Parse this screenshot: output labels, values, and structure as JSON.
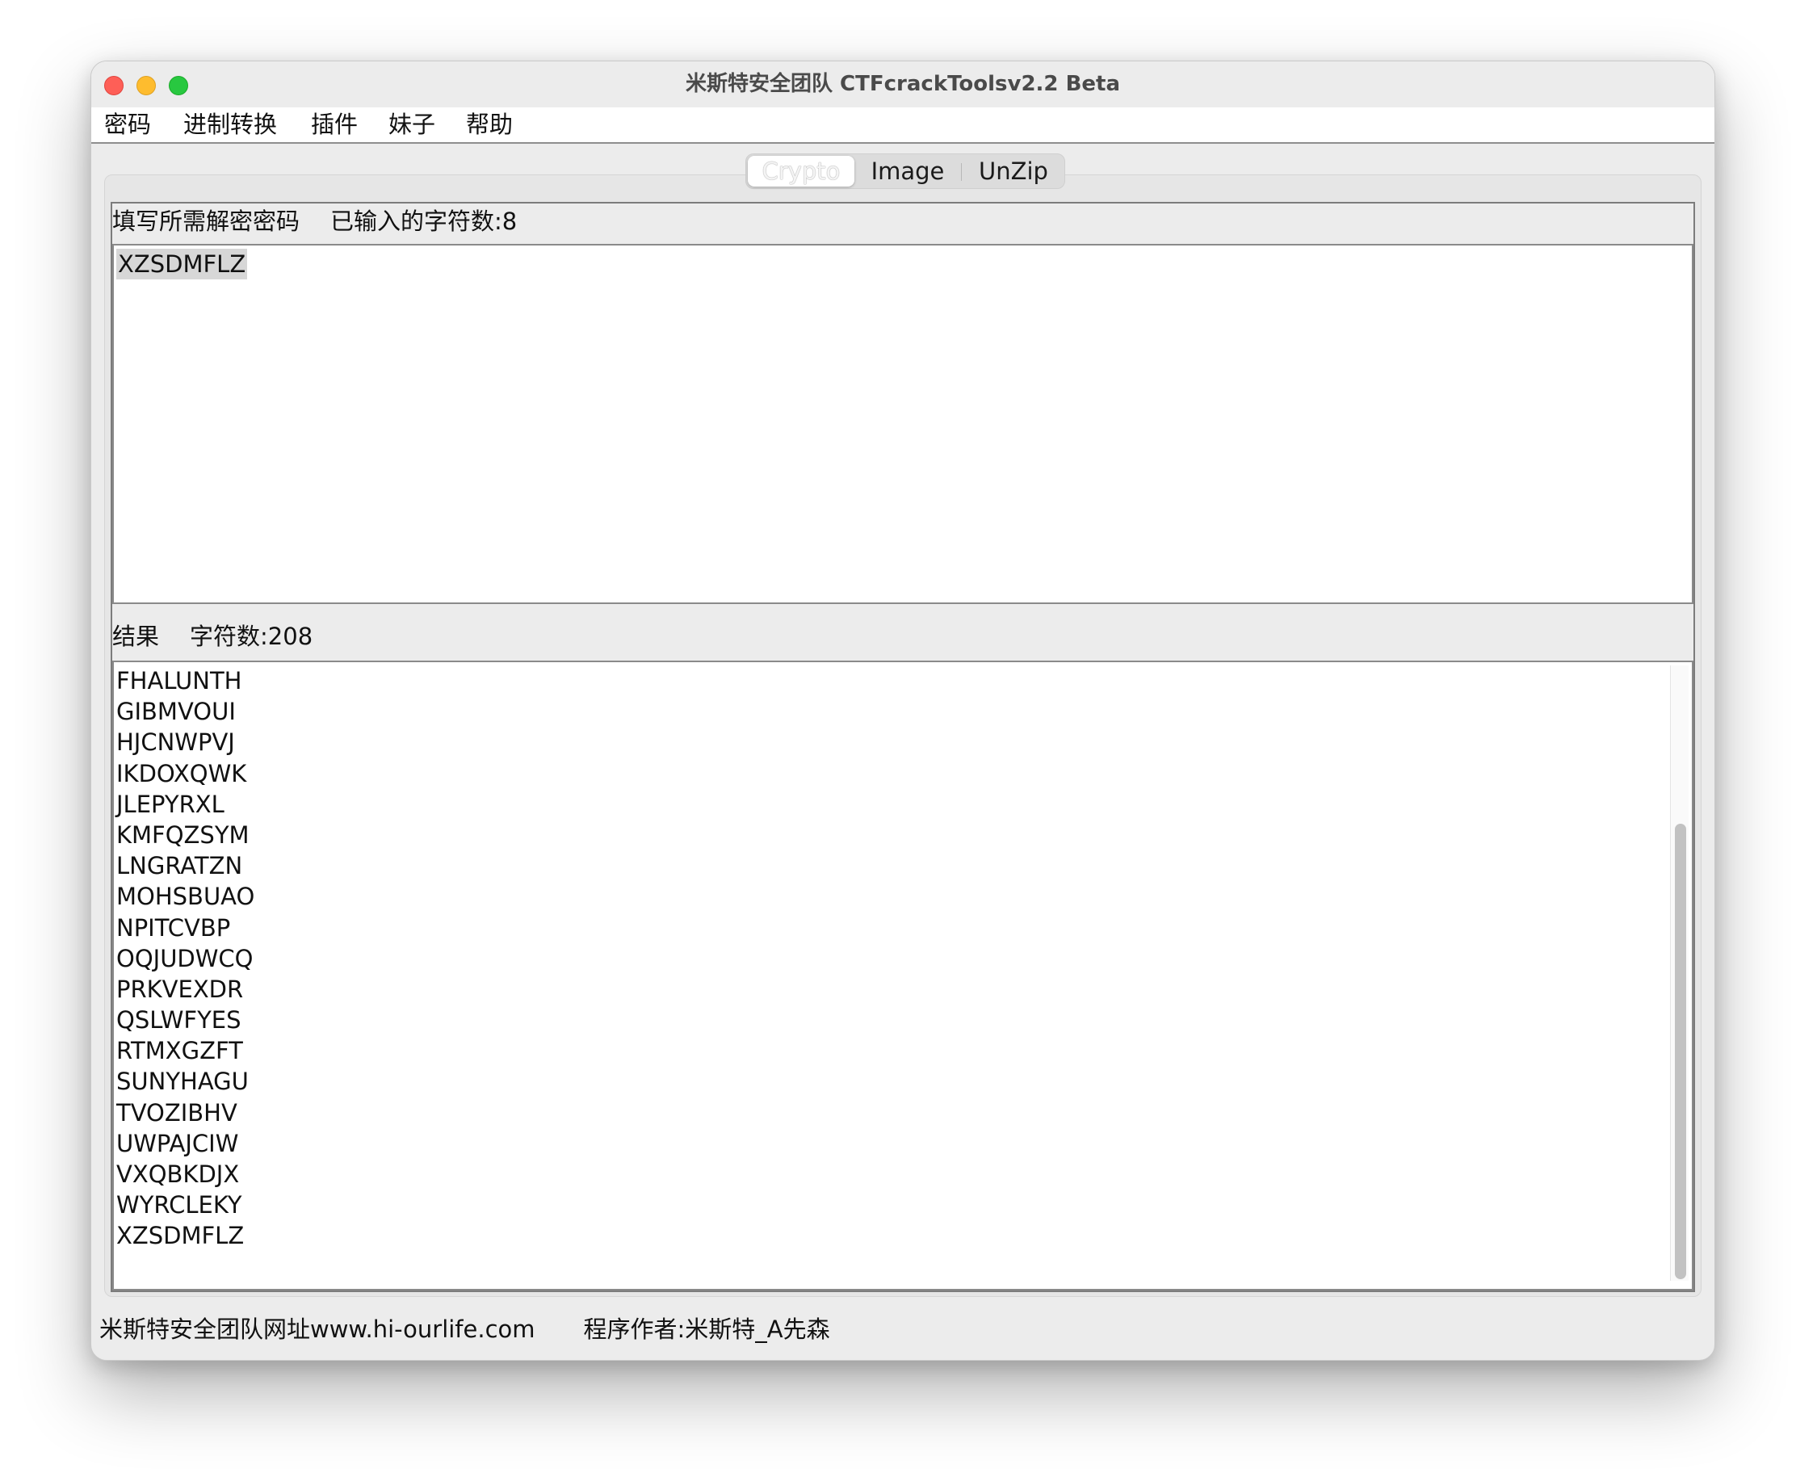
{
  "window": {
    "title": "米斯特安全团队 CTFcrackToolsv2.2 Beta"
  },
  "menu": {
    "items": [
      "密码",
      "进制转换",
      "插件",
      "妹子",
      "帮助"
    ]
  },
  "tabs": [
    {
      "label": "Crypto",
      "active": true
    },
    {
      "label": "Image",
      "active": false
    },
    {
      "label": "UnZip",
      "active": false
    }
  ],
  "input_section": {
    "label": "填写所需解密密码",
    "count_label": "已输入的字符数:8",
    "value": "XZSDMFLZ"
  },
  "result_section": {
    "label": "结果",
    "count_label": "字符数:208",
    "lines": [
      "FHALUNTH",
      "GIBMVOUI",
      "HJCNWPVJ",
      "IKDOXQWK",
      "JLEPYRXL",
      "KMFQZSYM",
      "LNGRATZN",
      "MOHSBUAO",
      "NPITCVBP",
      "OQJUDWCQ",
      "PRKVEXDR",
      "QSLWFYES",
      "RTMXGZFT",
      "SUNYHAGU",
      "TVOZIBHV",
      "UWPAJCIW",
      "VXQBKDJX",
      "WYRCLEKY",
      "XZSDMFLZ"
    ]
  },
  "status": {
    "site": "米斯特安全团队网址www.hi-ourlife.com",
    "author": "程序作者:米斯特_A先森"
  },
  "colors": {
    "close": "#fe5f57",
    "minimize": "#febc2e",
    "maximize": "#28c840"
  }
}
